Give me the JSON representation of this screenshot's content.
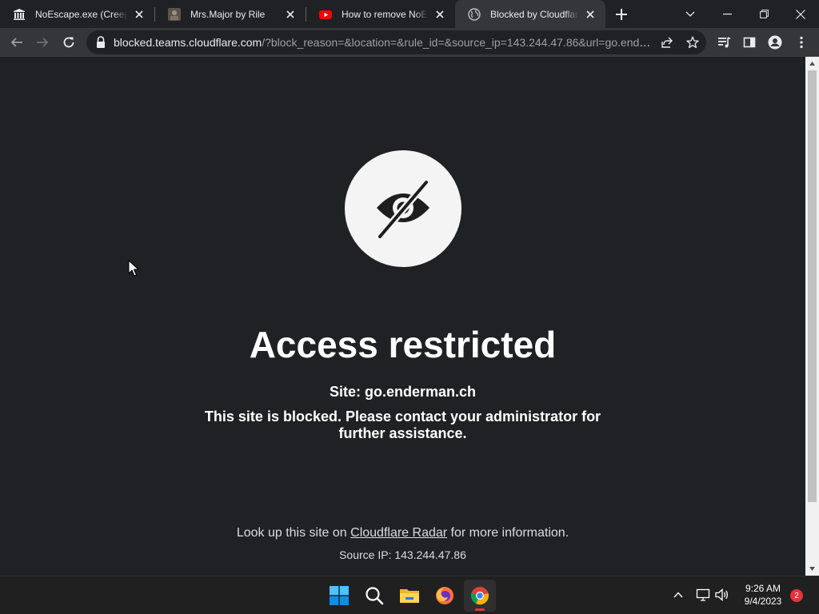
{
  "browser": {
    "tabs": [
      {
        "title": "NoEscape.exe (Creepypasta)",
        "favicon": "museum-icon"
      },
      {
        "title": "Mrs.Major by Rile",
        "favicon": "thumbnail-icon"
      },
      {
        "title": "How to remove NoEscape",
        "favicon": "youtube-icon"
      },
      {
        "title": "Blocked by Cloudflare Gateway",
        "favicon": "globe-icon"
      }
    ],
    "active_tab": 3,
    "address": {
      "host": "blocked.teams.cloudflare.com",
      "path": "/?block_reason=&location=&rule_id=&source_ip=143.244.47.86&url=go.enderman.ch"
    }
  },
  "page": {
    "icon": "eye-slash-icon",
    "heading": "Access restricted",
    "site_line": "Site: go.enderman.ch",
    "message": "This site is blocked. Please contact your administrator for further assistance.",
    "lookup_prefix": "Look up this site on ",
    "lookup_link": "Cloudflare Radar",
    "lookup_suffix": " for more information.",
    "source_ip": "Source IP: 143.244.47.86"
  },
  "taskbar": {
    "apps": [
      "windows-start-icon",
      "search-icon",
      "file-explorer-icon",
      "firefox-icon",
      "chrome-icon"
    ],
    "active_app": "chrome-icon",
    "time": "9:26 AM",
    "date": "9/4/2023",
    "notification_count": "2"
  },
  "colors": {
    "page_bg": "#202124",
    "tab_active": "#35363a",
    "badge": "#e3343d"
  }
}
